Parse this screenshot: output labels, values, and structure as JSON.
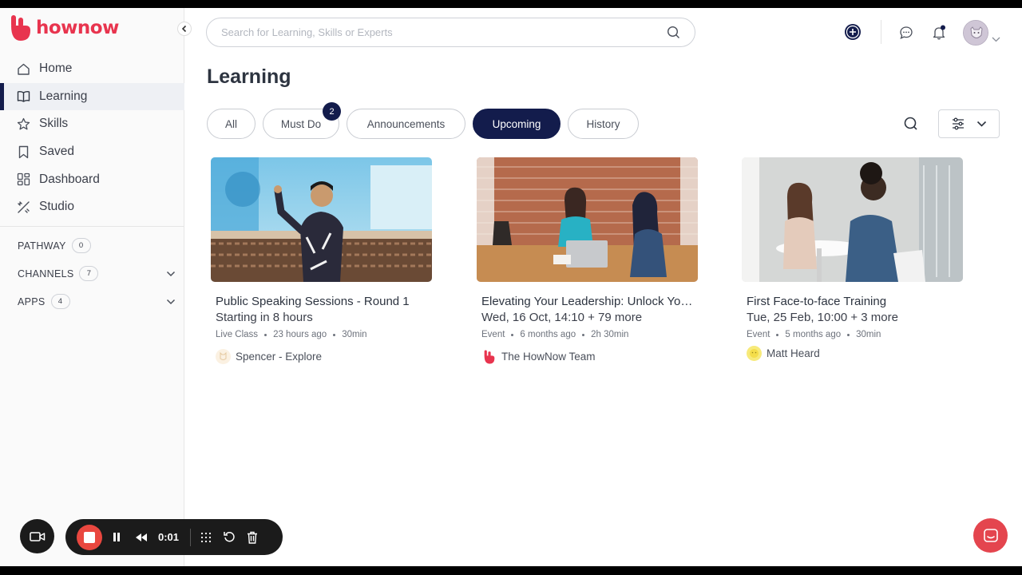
{
  "app": {
    "brand": "hownow"
  },
  "sidebar": {
    "items": [
      {
        "label": "Home",
        "icon": "home-icon"
      },
      {
        "label": "Learning",
        "icon": "book-icon",
        "active": true
      },
      {
        "label": "Skills",
        "icon": "star-icon"
      },
      {
        "label": "Saved",
        "icon": "bookmark-icon"
      },
      {
        "label": "Dashboard",
        "icon": "dashboard-icon"
      },
      {
        "label": "Studio",
        "icon": "studio-icon"
      }
    ],
    "sections": [
      {
        "label": "PATHWAY",
        "count": "0"
      },
      {
        "label": "CHANNELS",
        "count": "7"
      },
      {
        "label": "APPS",
        "count": "4"
      }
    ]
  },
  "header": {
    "search_placeholder": "Search for Learning, Skills or Experts"
  },
  "main": {
    "title": "Learning",
    "tabs": [
      {
        "label": "All"
      },
      {
        "label": "Must Do",
        "badge": "2"
      },
      {
        "label": "Announcements"
      },
      {
        "label": "Upcoming",
        "active": true
      },
      {
        "label": "History"
      }
    ],
    "cards": [
      {
        "title": "Public Speaking Sessions - Round 1",
        "subtitle": "Starting in 8 hours",
        "type": "Live Class",
        "time_ago": "23 hours ago",
        "duration": "30min",
        "author": "Spencer - Explore"
      },
      {
        "title": "Elevating Your Leadership: Unlock Your Potential",
        "subtitle": "Wed, 16 Oct, 14:10 + 79 more",
        "type": "Event",
        "time_ago": "6 months ago",
        "duration": "2h 30min",
        "author": "The HowNow Team"
      },
      {
        "title": "First Face-to-face Training",
        "subtitle": "Tue, 25 Feb, 10:00 + 3 more",
        "type": "Event",
        "time_ago": "5 months ago",
        "duration": "30min",
        "author": "Matt Heard"
      }
    ]
  },
  "recorder": {
    "time": "0:01"
  },
  "colors": {
    "brand": "#e8344e",
    "navy": "#131c4c",
    "record": "#e9473f"
  }
}
